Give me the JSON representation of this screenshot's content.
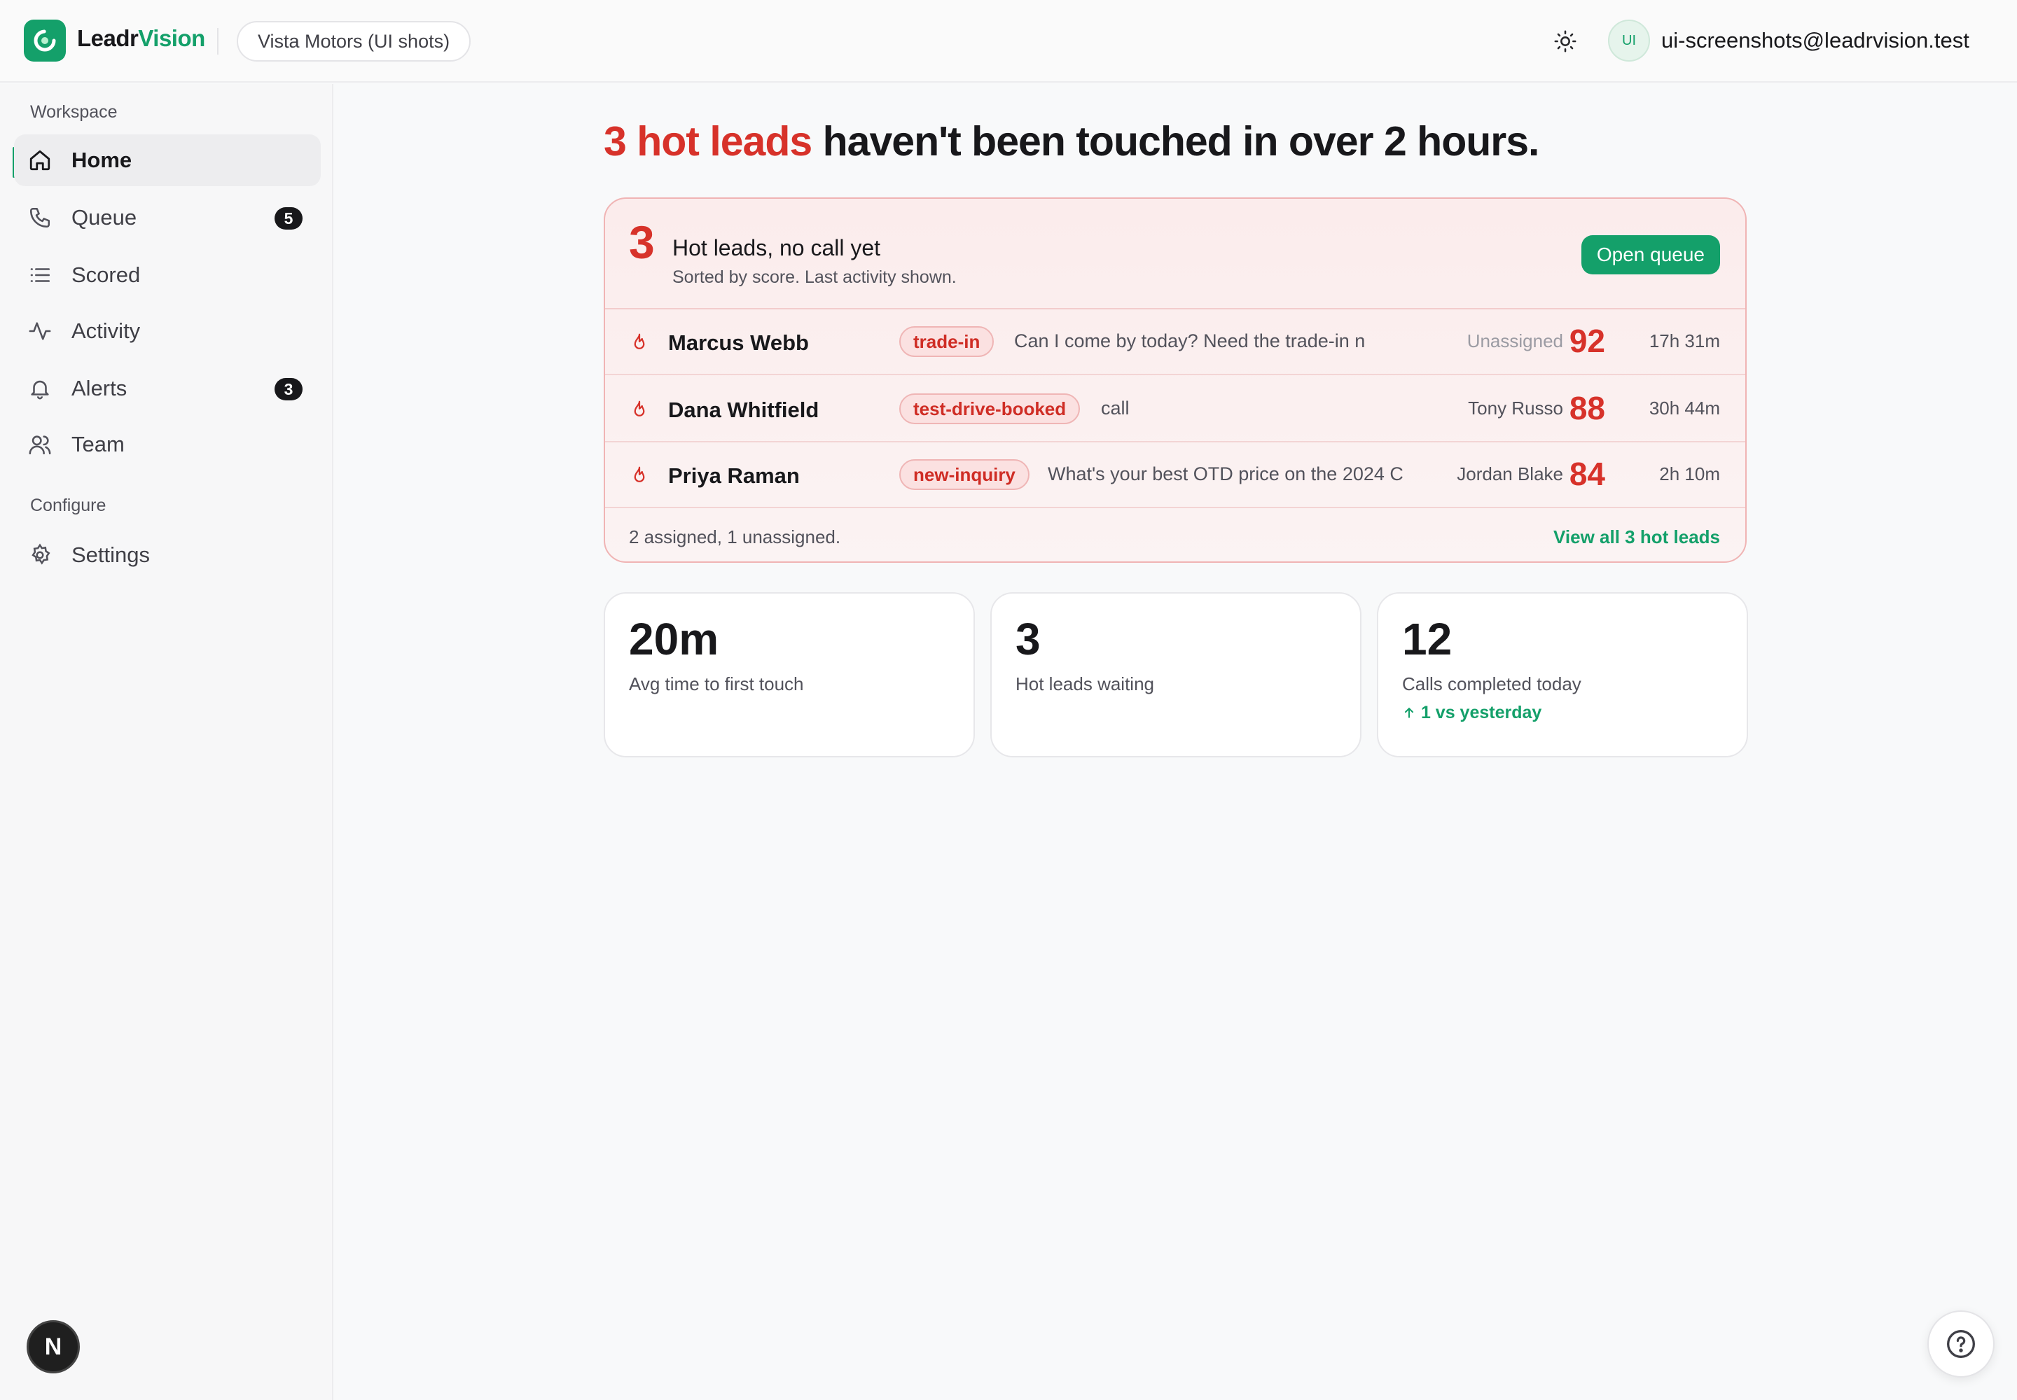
{
  "header": {
    "brand_part1": "Leadr",
    "brand_part2": "Vision",
    "workspace_name": "Vista Motors (UI shots)",
    "avatar_initials": "UI",
    "user_email": "ui-screenshots@leadrvision.test"
  },
  "sidebar": {
    "workspace_label": "Workspace",
    "configure_label": "Configure",
    "items": [
      {
        "label": "Home",
        "icon": "home-icon",
        "active": true
      },
      {
        "label": "Queue",
        "icon": "phone-icon",
        "badge": "5"
      },
      {
        "label": "Scored",
        "icon": "list-icon"
      },
      {
        "label": "Activity",
        "icon": "activity-icon"
      },
      {
        "label": "Alerts",
        "icon": "bell-icon",
        "badge": "3"
      },
      {
        "label": "Team",
        "icon": "users-icon"
      }
    ],
    "settings_label": "Settings",
    "dev_badge": "N"
  },
  "main": {
    "headline_highlight": "3 hot leads",
    "headline_rest": " haven't been touched in over 2 hours.",
    "hot_card": {
      "count": "3",
      "title": "Hot leads, no call yet",
      "subtitle": "Sorted by score. Last activity shown.",
      "open_queue_label": "Open queue",
      "leads": [
        {
          "name": "Marcus Webb",
          "tag": "trade-in",
          "message": "Can I come by today? Need the trade-in n",
          "assignee": "Unassigned",
          "score": "92",
          "age": "17h 31m"
        },
        {
          "name": "Dana Whitfield",
          "tag": "test-drive-booked",
          "message": "call",
          "assignee": "Tony Russo",
          "score": "88",
          "age": "30h 44m"
        },
        {
          "name": "Priya Raman",
          "tag": "new-inquiry",
          "message": "What's your best OTD price on the 2024 C",
          "assignee": "Jordan Blake",
          "score": "84",
          "age": "2h 10m"
        }
      ],
      "summary": "2 assigned, 1 unassigned.",
      "view_all_label": "View all 3 hot leads"
    },
    "stats": [
      {
        "value": "20m",
        "label": "Avg time to first touch"
      },
      {
        "value": "3",
        "label": "Hot leads waiting"
      },
      {
        "value": "12",
        "label": "Calls completed today",
        "delta": "1 vs yesterday"
      }
    ]
  },
  "colors": {
    "brand": "#14a06a",
    "hot": "#d7322a"
  }
}
